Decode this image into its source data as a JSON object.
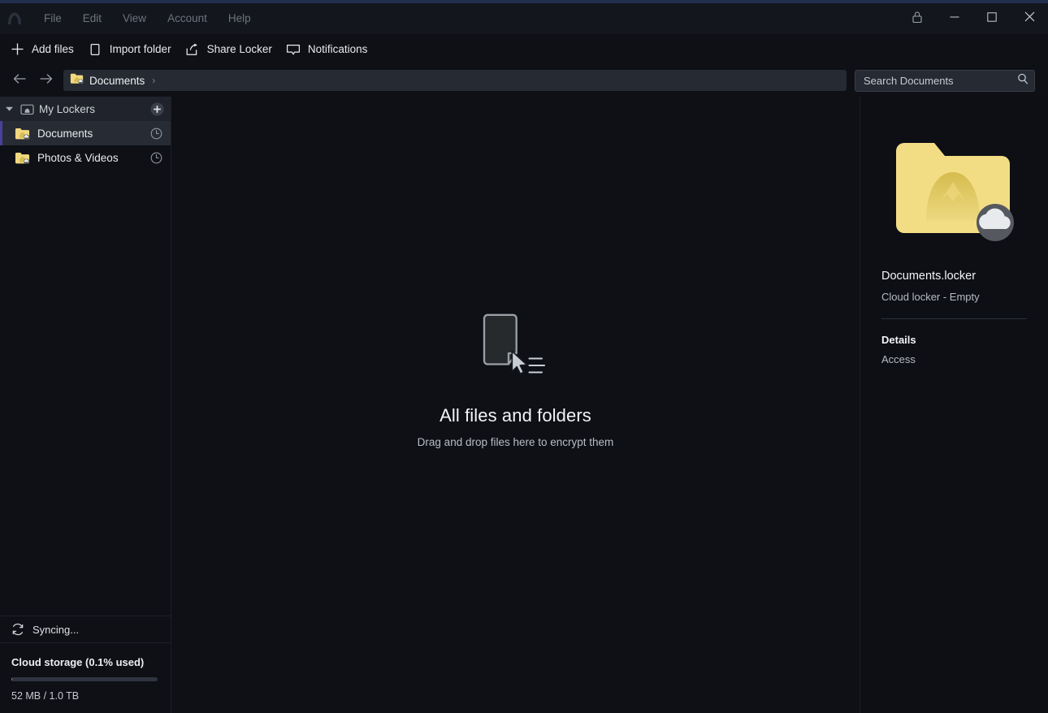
{
  "window": {
    "accent_color": "#21304d",
    "logo_icon": "nordlocker-mountain-logo",
    "menu": [
      {
        "label": "File"
      },
      {
        "label": "Edit"
      },
      {
        "label": "View"
      },
      {
        "label": "Account"
      },
      {
        "label": "Help"
      }
    ],
    "controls": [
      {
        "name": "lock-app",
        "icon": "lock-icon",
        "glyph": "lock"
      },
      {
        "name": "minimize",
        "icon": "minimize-icon",
        "glyph": "minimize"
      },
      {
        "name": "maximize",
        "icon": "maximize-icon",
        "glyph": "maximize"
      },
      {
        "name": "close",
        "icon": "close-icon",
        "glyph": "close"
      }
    ]
  },
  "toolbar": {
    "add_files_label": "Add files",
    "import_folder_label": "Import folder",
    "share_locker_label": "Share Locker",
    "notifications_label": "Notifications"
  },
  "navigation": {
    "back_icon": "arrow-left-icon",
    "forward_icon": "arrow-right-icon",
    "breadcrumb": {
      "icon": "locker-folder-icon",
      "label": "Documents",
      "separator": "›"
    }
  },
  "search": {
    "placeholder": "Search Documents",
    "value": "",
    "icon": "search-icon"
  },
  "sidebar": {
    "header": {
      "label": "My Lockers",
      "expand_icon": "chevron-down-icon",
      "group_icon": "lockers-group-icon",
      "add_icon": "plus-circle-icon"
    },
    "items": [
      {
        "label": "Documents",
        "icon": "locker-folder-cloud-icon",
        "status_icon": "pending-clock-icon",
        "selected": true
      },
      {
        "label": "Photos & Videos",
        "icon": "locker-folder-cloud-icon",
        "status_icon": "pending-clock-icon",
        "selected": false
      }
    ],
    "sync": {
      "label": "Syncing...",
      "icon": "sync-refresh-icon"
    },
    "storage": {
      "title": "Cloud storage (0.1% used)",
      "usage": "52 MB / 1.0 TB",
      "percent": 0.1,
      "bar_color": "#7f8795"
    }
  },
  "main": {
    "empty_state": {
      "icon": "document-drag-drop-icon",
      "title": "All files and folders",
      "subtitle": "Drag and drop files here to encrypt them"
    }
  },
  "details_panel": {
    "thumbnail_icon": "locker-folder-cloud-large-icon",
    "name": "Documents.locker",
    "meta": "Cloud locker - Empty",
    "tabs": [
      {
        "label": "Details",
        "active": true
      },
      {
        "label": "Access",
        "active": false
      }
    ]
  },
  "colors": {
    "background": "#0e1015",
    "selection_accent": "#4b3f9e",
    "folder_yellow": "#f2dd85",
    "titlebar": "#13161d"
  }
}
